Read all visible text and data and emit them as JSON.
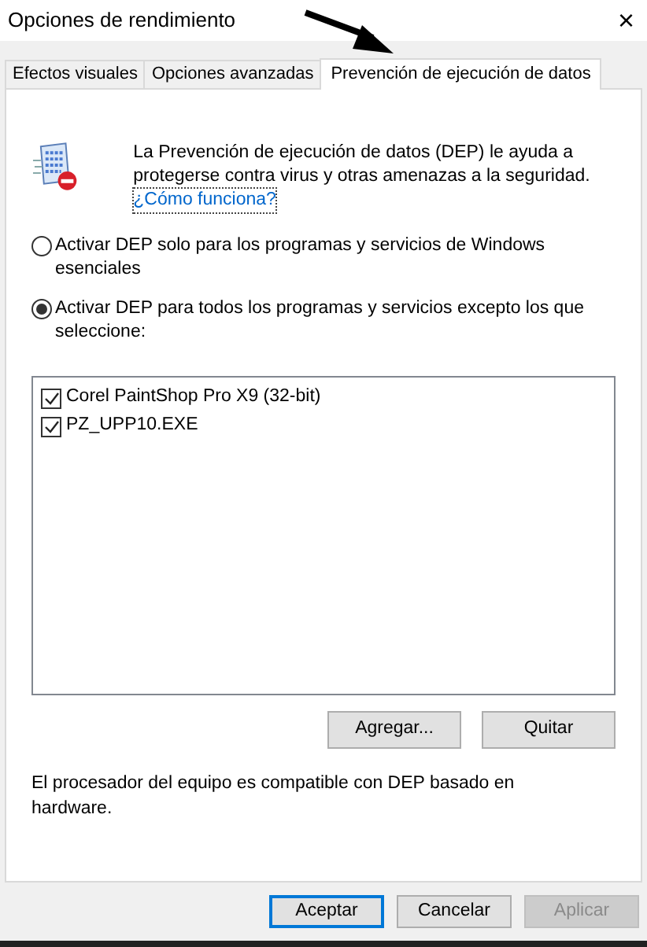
{
  "window": {
    "title": "Opciones de rendimiento",
    "close": "×"
  },
  "tabs": [
    {
      "label": "Efectos visuales",
      "selected": false
    },
    {
      "label": "Opciones avanzadas",
      "selected": false
    },
    {
      "label": "Prevención de ejecución de datos",
      "selected": true
    }
  ],
  "intro": {
    "text": "La Prevención de ejecución de datos (DEP) le ayuda a protegerse contra virus y otras amenazas a la seguridad.",
    "link": "¿Cómo funciona?"
  },
  "options": [
    {
      "label": "Activar DEP solo para los programas y servicios de Windows esenciales",
      "selected": false
    },
    {
      "label": "Activar DEP para todos los programas y servicios excepto los que seleccione:",
      "selected": true
    }
  ],
  "programs": [
    {
      "name": "Corel PaintShop Pro X9 (32-bit)",
      "checked": true
    },
    {
      "name": "PZ_UPP10.EXE",
      "checked": true
    }
  ],
  "list_buttons": [
    "Agregar...",
    "Quitar"
  ],
  "note": "El procesador del equipo es compatible con DEP basado en hardware.",
  "buttons": [
    {
      "label": "Aceptar",
      "disabled": false,
      "default": true
    },
    {
      "label": "Cancelar",
      "disabled": false,
      "default": false
    },
    {
      "label": "Aplicar",
      "disabled": true,
      "default": false
    }
  ]
}
